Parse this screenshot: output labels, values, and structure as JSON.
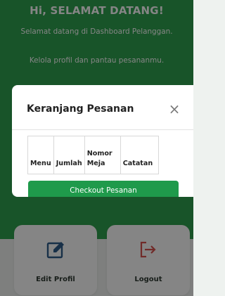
{
  "hero": {
    "title": "Hi, SELAMAT DATANG!",
    "subtitle": "Selamat datang di Dashboard Pelanggan.",
    "subtitle2": "Kelola profil dan pantau pesananmu."
  },
  "cards": [
    {
      "label": "Edit Profil",
      "icon": "edit-icon"
    },
    {
      "label": "Logout",
      "icon": "logout-icon"
    }
  ],
  "modal": {
    "title": "Keranjang Pesanan",
    "close_symbol": "×",
    "columns": [
      "Menu",
      "Jumlah",
      "Nomor Meja",
      "Catatan"
    ],
    "checkout_label": "Checkout Pesanan"
  },
  "colors": {
    "primary_green": "#2fa24f",
    "button_green": "#1f9a4b",
    "logout_red": "#d9534f"
  }
}
